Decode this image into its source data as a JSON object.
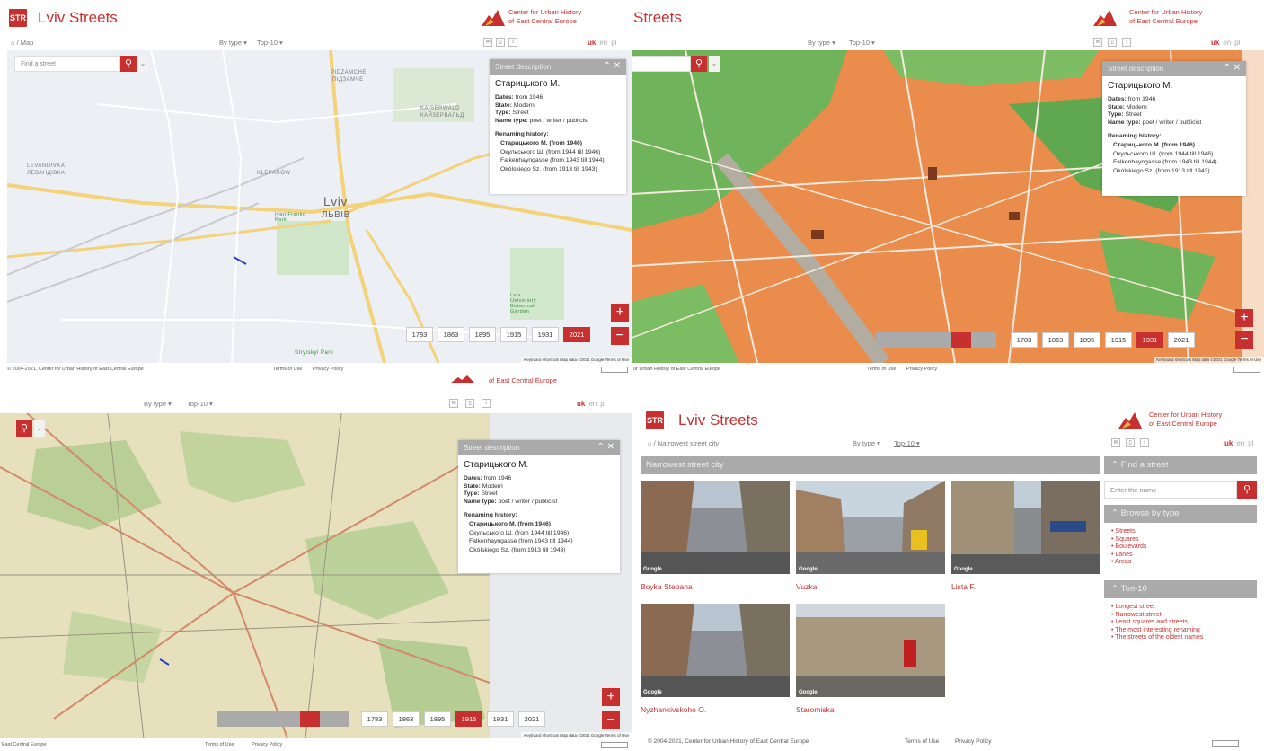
{
  "app": {
    "logo": "STR",
    "title": "Lviv Streets",
    "title_partial": "Streets",
    "org_line1": "Center for Urban History",
    "org_line2": "of East Central Europe"
  },
  "nav": {
    "home_map": "⌂ / Map",
    "by_type": "By type ▾",
    "top10": "Top-10 ▾",
    "langs": {
      "uk": "uk",
      "en": "en",
      "pl": "pl"
    }
  },
  "search": {
    "placeholder": "Find a street",
    "placeholder_alt": "Enter the name"
  },
  "description": {
    "header": "Street description",
    "name": "Старицького М.",
    "dates_label": "Dates:",
    "dates_value": "from 1946",
    "state_label": "State:",
    "state_value": "Modern",
    "type_label": "Type:",
    "type_value": "Street",
    "name_type_label": "Name type:",
    "name_type_value": "poet / writer / publicist",
    "renaming_label": "Renaming history:",
    "history": [
      "Старицького М. (from 1946)",
      "Окульського Ш. (from 1944 till 1946)",
      "Falkenhayngasse (from 1943 till 1944)",
      "Okólskiego Sz. (from 1913 till 1943)"
    ]
  },
  "years": [
    "1783",
    "1863",
    "1895",
    "1915",
    "1931",
    "2021"
  ],
  "zoom": {
    "plus": "+",
    "minus": "−"
  },
  "map_labels": {
    "city_latin": "Lviv",
    "city_cyr": "ЛЬВІВ",
    "pidzamche": "PIDZAMCHE",
    "pidzamche_cyr": "ПІДЗАМЧЕ",
    "kaiserwald": "KAISERWALD",
    "kaiserwald_cyr": "КАЙЗЕРВАЛЬД",
    "levandivka": "LEVANDIVKA",
    "levandivka_cyr": "ЛЕВАНДІВКА",
    "kleparow": "KLEPARÓW",
    "park": "Ivan Franko Park",
    "garden": "Lviv University Botanical Garden",
    "stryiskyi": "Stryiskyi Park",
    "map_footer": "Keyboard shortcuts   Map data ©2021 Google   Terms of Use"
  },
  "footer": {
    "copyright": "© 2004-2021, Center for Urban History of East Central Europe",
    "copyright_partial": "ur Urban History of East Central Europe",
    "copyright_short": "East Central Europe",
    "terms": "Terms of Use",
    "privacy": "Privacy Policy"
  },
  "list_page": {
    "crumb": "⌂ / Narrowest street city",
    "heading": "Narrowest street city",
    "items": [
      "Boyka Stepana",
      "Vuzka",
      "Lista F.",
      "Nyzhankivskoho O.",
      "Staromiska"
    ],
    "google": "Google",
    "find_header": "⌃ Find a street",
    "browse_header": "⌃ Browse by type",
    "browse": [
      "Streets",
      "Squares",
      "Boulevards",
      "Lanes",
      "Areas"
    ],
    "top_header": "⌃ Топ-10",
    "top": [
      "Longest street",
      "Narrowest street",
      "Least squares and streets",
      "The most interesting renaming",
      "The streets of the oldest names"
    ]
  },
  "colors": {
    "accent": "#c8302f",
    "panel_header": "#aaaaaa"
  }
}
